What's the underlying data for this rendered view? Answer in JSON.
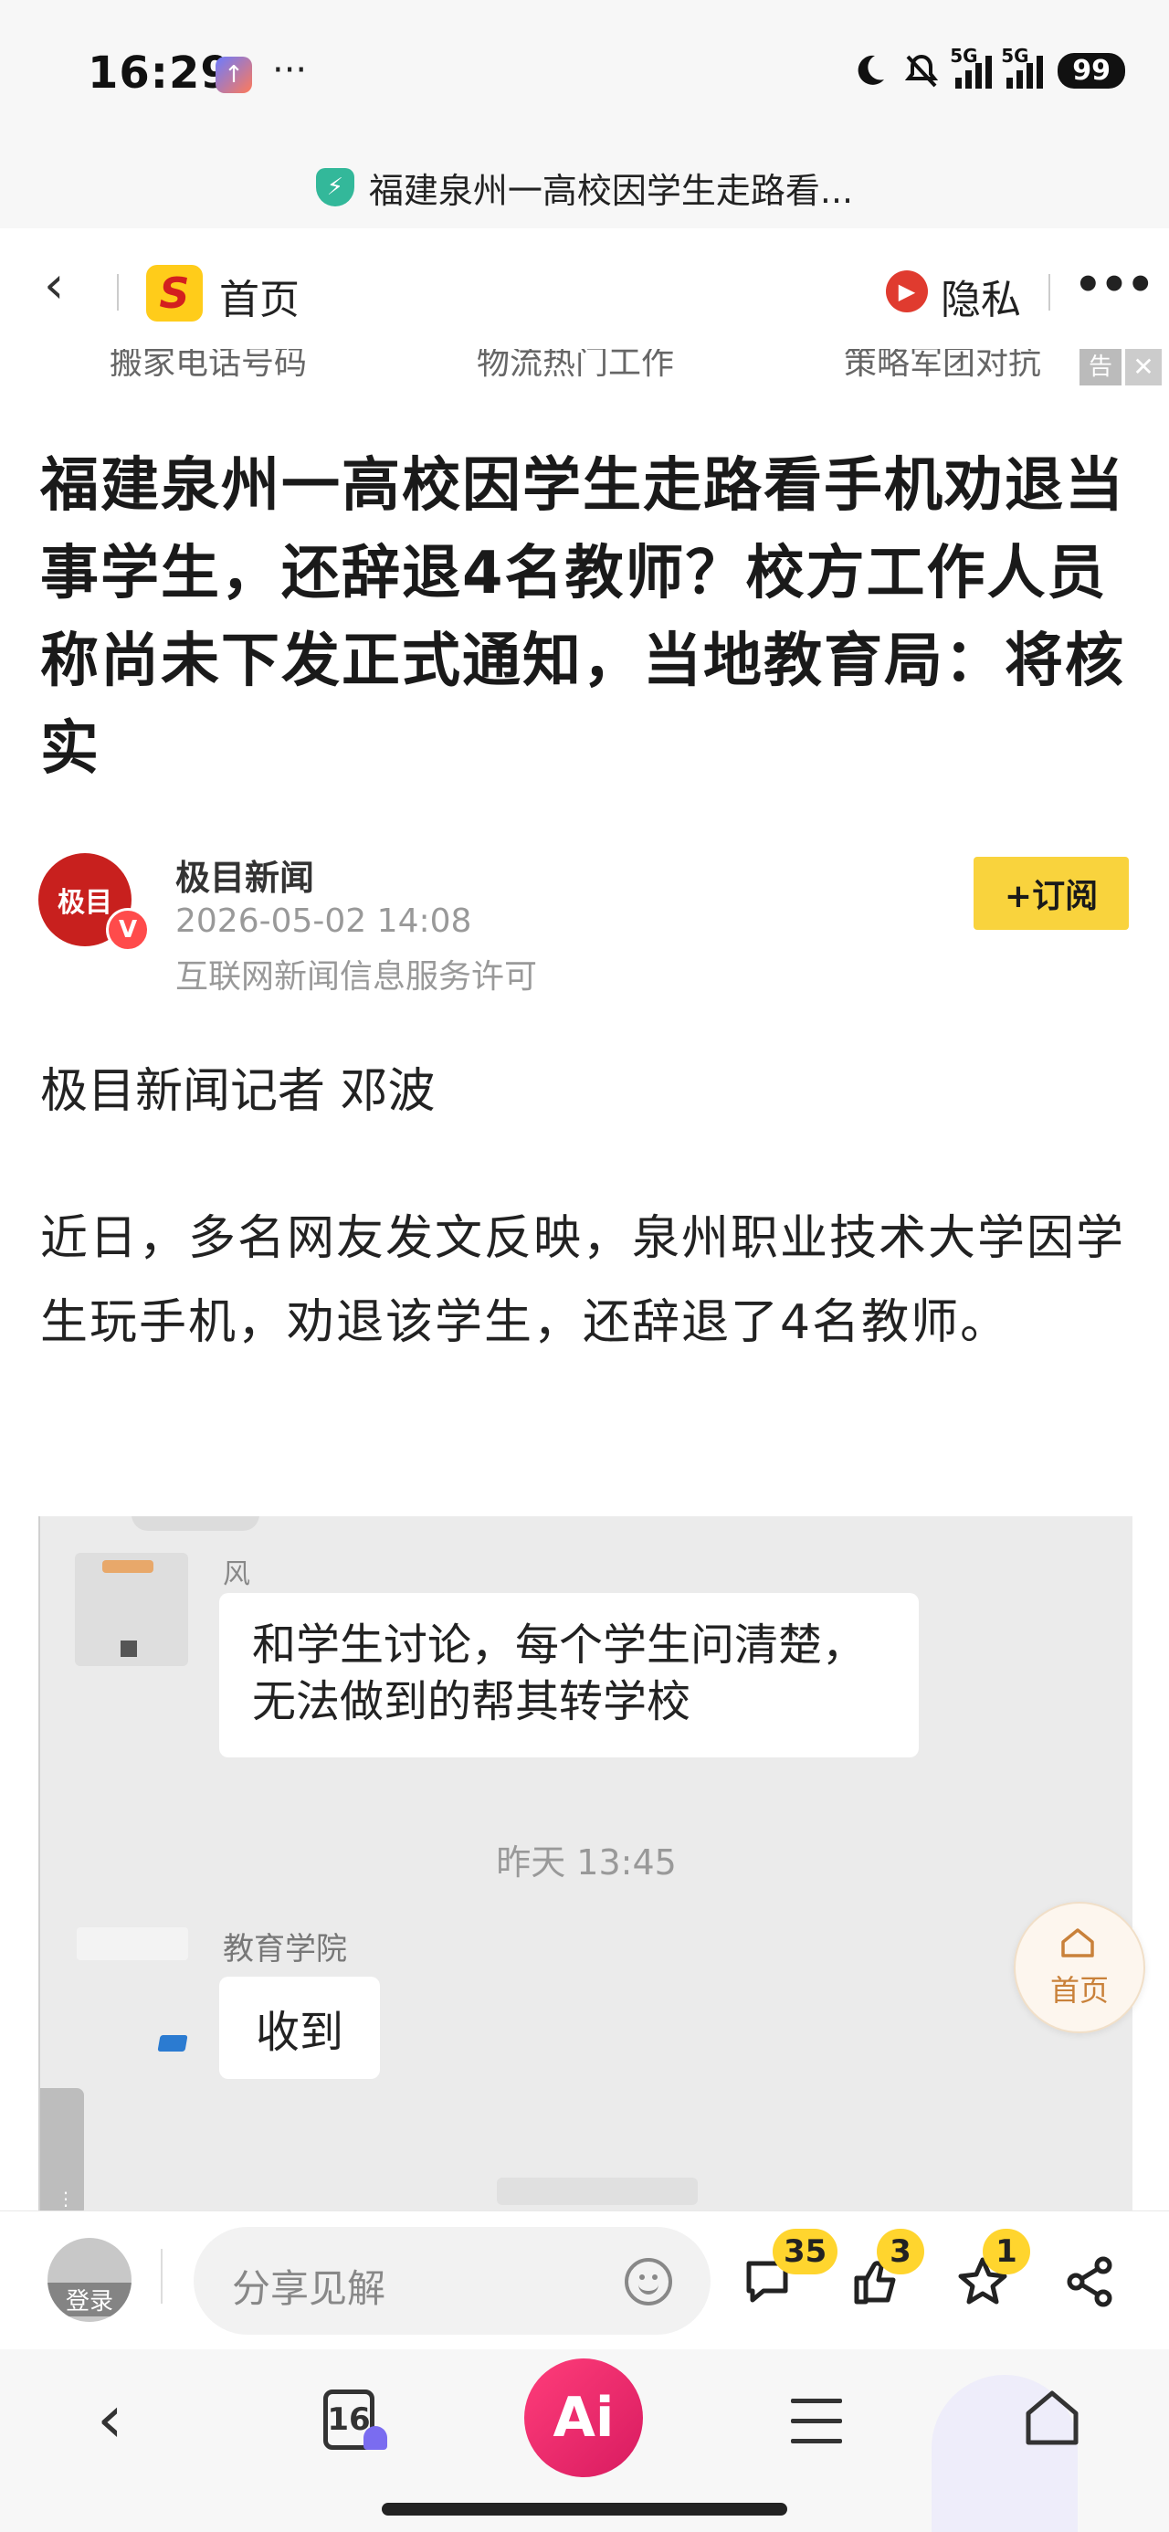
{
  "status_bar": {
    "time": "16:29",
    "app_icon": "↑",
    "more": "···",
    "battery": "99",
    "signal_label_1": "5G",
    "signal_label_2": "5G",
    "icons": [
      "moon-icon",
      "mute-bell-icon",
      "signal-icon",
      "signal-icon",
      "battery-icon"
    ]
  },
  "url_bar": {
    "title": "福建泉州一高校因学生走路看..."
  },
  "nav": {
    "back": "‹",
    "home_label": "首页",
    "logo_letter": "S",
    "privacy_label": "隐私",
    "more": "•••"
  },
  "ad_strip": {
    "items": [
      "搬家电话号码",
      "物流热门工作",
      "策略军团对抗"
    ],
    "tag": "告",
    "close": "✕"
  },
  "article": {
    "title": "福建泉州一高校因学生走路看手机劝退当事学生，还辞退4名教师？校方工作人员称尚未下发正式通知，当地教育局：将核实",
    "author": {
      "avatar_text": "极目",
      "verified": "V",
      "name": "极目新闻",
      "time": "2026-05-02 14:08",
      "license": "互联网新闻信息服务许可",
      "subscribe": "+订阅"
    },
    "byline": "极目新闻记者 邓波",
    "paragraph_1": "近日，多名网友发文反映，泉州职业技术大学因学生玩手机，劝退该学生，还辞退了4名教师。"
  },
  "chat_image": {
    "sender1_name": "风",
    "message1_line1": "和学生讨论，每个学生问清楚，",
    "message1_line2": "无法做到的帮其转学校",
    "timestamp": "昨天 13:45",
    "sender2_name": "教育学院",
    "message2": "收到"
  },
  "float_home": {
    "label": "首页"
  },
  "comment_bar": {
    "login": "登录",
    "placeholder": "分享见解",
    "comments_count": "35",
    "likes_count": "3",
    "favorites_count": "1"
  },
  "bottom_nav": {
    "back": "‹",
    "tabs_count": "16",
    "ai_label": "Ai"
  },
  "colors": {
    "accent_yellow": "#f9d33d",
    "badge_yellow": "#ffd52e",
    "ai_pink": "#e5265f",
    "shield_green": "#33b89a"
  }
}
